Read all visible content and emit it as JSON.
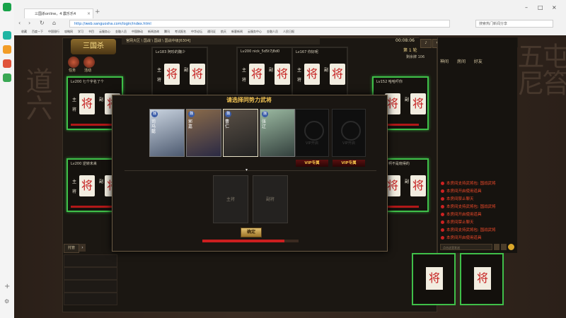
{
  "browser": {
    "tab_title": "三国杀online，4 震乐乐4",
    "url": "http://web.sanguosha.com/login/index.html",
    "search_placeholder": "搜索热门新闻分享",
    "bookmarks": [
      "收藏",
      "百度一下",
      "中国银行",
      "攻略网",
      "学习",
      "书目",
      "云服务心",
      "金融人员",
      "中国移动",
      "新闻咨询",
      "腾讯",
      "考试报名",
      "中华论坛",
      "通讯证",
      "航天",
      "新客新闻",
      "云服务中心",
      "金融人员",
      "人民日报"
    ]
  },
  "game": {
    "logo": "三国杀",
    "breadcrumb": "官网大区 \\ 国战 \\ 国战 \\ 国战中级[6304]",
    "role_buttons": [
      {
        "label": "任务"
      },
      {
        "label": "活动"
      }
    ],
    "timer": "00:08:06",
    "round_label": "第 1 轮",
    "remaining_label": "剩余牌 106",
    "top_buttons": [
      "♪",
      "⚙",
      "✦",
      "⬛",
      "私",
      "回",
      "退",
      "新"
    ],
    "seats": [
      {
        "name": "Lv183 阿珍的魏少",
        "green": false
      },
      {
        "name": "Lv200 nick_5d5t7j8d0",
        "green": false
      },
      {
        "name": "Lv167 你好呢",
        "green": false
      },
      {
        "name": "Lv200 七个字名了个",
        "green": true
      },
      {
        "name": "Lv152 哈哈吓你",
        "green": true
      },
      {
        "name": "Lv200 逆转未来",
        "green": true
      },
      {
        "name": "Lv200 啊不是晓得的",
        "green": true
      }
    ],
    "seat_tags": {
      "zhu": "主",
      "jiang": "将",
      "fu": "副"
    },
    "jiang_glyph": "将",
    "right_tabs": [
      "神间",
      "房间",
      "好友"
    ],
    "log_lines": [
      "本房间支持武将包: 国战武将",
      "本房间开启使用道具",
      "本房间禁止聊天",
      "本房间支持武将包: 国战武将",
      "本房间开启使用道具",
      "本房间禁止聊天",
      "本房间支持武将包: 国战武将",
      "本房间开启使用道具"
    ],
    "chat_placeholder": "点击这里发送",
    "managed_label": "托管",
    "dialog": {
      "title": "请选择同势力武将",
      "cards": [
        {
          "name": "司马懿",
          "power": "魏",
          "color": "#3a5ca8"
        },
        {
          "name": "郭嘉",
          "power": "魏",
          "color": "#3a5ca8"
        },
        {
          "name": "曹仁",
          "power": "魏",
          "color": "#3a5ca8"
        },
        {
          "name": "张辽",
          "power": "魏",
          "color": "#3a5ca8"
        }
      ],
      "vip_slots": [
        {
          "text": "VIP开启",
          "button": "VIP专属"
        },
        {
          "text": "VIP开启",
          "button": "VIP专属"
        }
      ],
      "main_slot": "主将",
      "deputy_slot": "副将",
      "confirm": "确定",
      "progress": 0.85
    }
  }
}
